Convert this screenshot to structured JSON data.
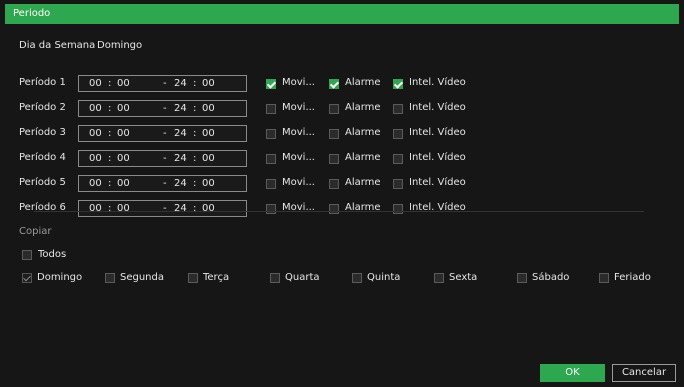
{
  "window": {
    "title": "Periodo"
  },
  "day": {
    "label": "Dia da Semana",
    "value": "Domingo"
  },
  "periods": [
    {
      "label": "Período 1",
      "start_h": "00",
      "start_m": "00",
      "end_h": "24",
      "end_m": "00",
      "motion": true,
      "alarm": true,
      "ivs": true
    },
    {
      "label": "Período 2",
      "start_h": "00",
      "start_m": "00",
      "end_h": "24",
      "end_m": "00",
      "motion": false,
      "alarm": false,
      "ivs": false
    },
    {
      "label": "Período 3",
      "start_h": "00",
      "start_m": "00",
      "end_h": "24",
      "end_m": "00",
      "motion": false,
      "alarm": false,
      "ivs": false
    },
    {
      "label": "Período 4",
      "start_h": "00",
      "start_m": "00",
      "end_h": "24",
      "end_m": "00",
      "motion": false,
      "alarm": false,
      "ivs": false
    },
    {
      "label": "Período 5",
      "start_h": "00",
      "start_m": "00",
      "end_h": "24",
      "end_m": "00",
      "motion": false,
      "alarm": false,
      "ivs": false
    },
    {
      "label": "Período 6",
      "start_h": "00",
      "start_m": "00",
      "end_h": "24",
      "end_m": "00",
      "motion": false,
      "alarm": false,
      "ivs": false
    }
  ],
  "event_labels": {
    "motion": "Movi...",
    "alarm": "Alarme",
    "ivs": "Intel. Vídeo"
  },
  "time_sep": {
    "colon": ":",
    "dash": "-"
  },
  "copy": {
    "title": "Copiar",
    "all_label": "Todos",
    "all_checked": false,
    "days": [
      {
        "label": "Domingo",
        "state": "disabled-checked"
      },
      {
        "label": "Segunda",
        "state": "off"
      },
      {
        "label": "Terça",
        "state": "off"
      },
      {
        "label": "Quarta",
        "state": "off"
      },
      {
        "label": "Quinta",
        "state": "off"
      },
      {
        "label": "Sexta",
        "state": "off"
      },
      {
        "label": "Sábado",
        "state": "off"
      },
      {
        "label": "Feriado",
        "state": "off"
      }
    ]
  },
  "buttons": {
    "ok": "OK",
    "cancel": "Cancelar"
  },
  "colors": {
    "accent": "#2ea84f",
    "background": "#1e1e1e"
  }
}
